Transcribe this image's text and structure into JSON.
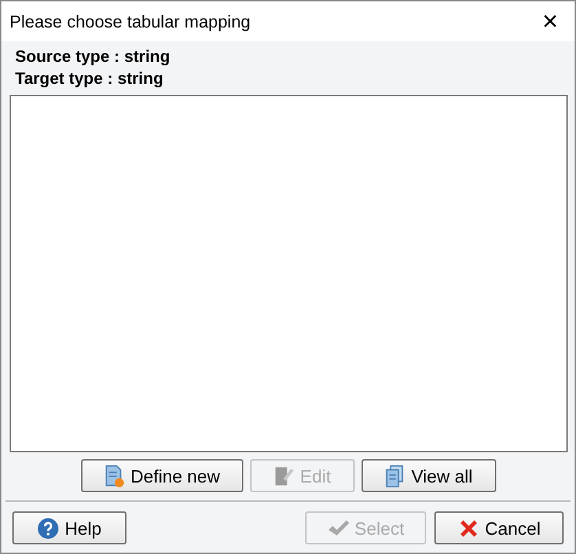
{
  "window": {
    "title": "Please choose tabular mapping",
    "close": "×"
  },
  "info": [
    "Source type : string",
    "Target type : string"
  ],
  "list_buttons": [
    {
      "label": "Define new",
      "kind": "new",
      "disabled": false
    },
    {
      "label": "Edit",
      "kind": "edit",
      "disabled": true
    },
    {
      "label": "View all",
      "kind": "viewall",
      "disabled": false
    }
  ],
  "footer_buttons": [
    {
      "label": "Help",
      "kind": "help",
      "disabled": false
    },
    {
      "label": "Select",
      "kind": "select",
      "disabled": true
    },
    {
      "label": "Cancel",
      "kind": "cancel",
      "disabled": false
    }
  ]
}
